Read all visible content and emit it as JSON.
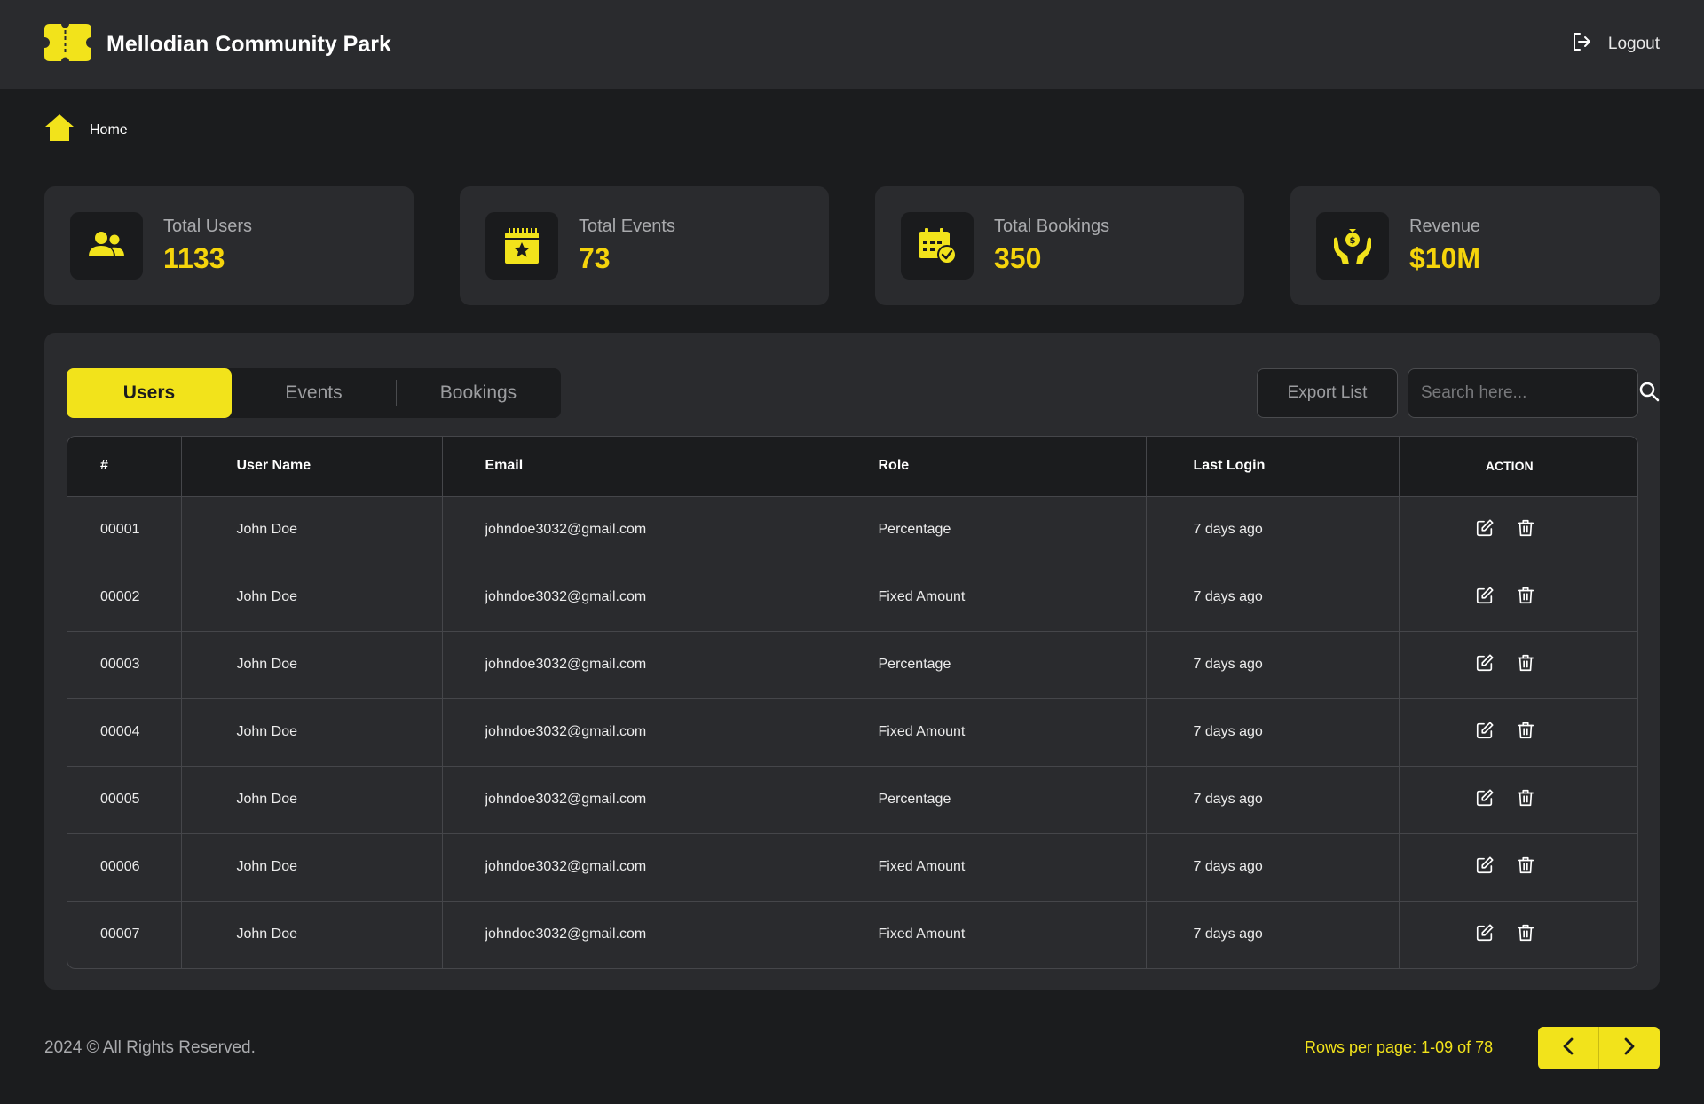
{
  "app": {
    "title": "Mellodian Community Park",
    "logout_label": "Logout"
  },
  "breadcrumb": {
    "home_label": "Home"
  },
  "stats": [
    {
      "label": "Total Users",
      "value": "1133",
      "icon": "users-icon"
    },
    {
      "label": "Total Events",
      "value": "73",
      "icon": "calendar-star-icon"
    },
    {
      "label": "Total Bookings",
      "value": "350",
      "icon": "calendar-check-icon"
    },
    {
      "label": "Revenue",
      "value": "$10M",
      "icon": "money-hands-icon"
    }
  ],
  "tabs": [
    {
      "label": "Users",
      "active": true
    },
    {
      "label": "Events",
      "active": false
    },
    {
      "label": "Bookings",
      "active": false
    }
  ],
  "toolbar": {
    "export_label": "Export List",
    "search_placeholder": "Search here..."
  },
  "table": {
    "headers": [
      "#",
      "User Name",
      "Email",
      "Role",
      "Last Login",
      "ACTION"
    ],
    "rows": [
      {
        "id": "00001",
        "name": "John Doe",
        "email": "johndoe3032@gmail.com",
        "role": "Percentage",
        "last_login": "7 days ago"
      },
      {
        "id": "00002",
        "name": "John Doe",
        "email": "johndoe3032@gmail.com",
        "role": "Fixed Amount",
        "last_login": "7 days ago"
      },
      {
        "id": "00003",
        "name": "John Doe",
        "email": "johndoe3032@gmail.com",
        "role": "Percentage",
        "last_login": "7 days ago"
      },
      {
        "id": "00004",
        "name": "John Doe",
        "email": "johndoe3032@gmail.com",
        "role": "Fixed Amount",
        "last_login": "7 days ago"
      },
      {
        "id": "00005",
        "name": "John Doe",
        "email": "johndoe3032@gmail.com",
        "role": "Percentage",
        "last_login": "7 days ago"
      },
      {
        "id": "00006",
        "name": "John Doe",
        "email": "johndoe3032@gmail.com",
        "role": "Fixed Amount",
        "last_login": "7 days ago"
      },
      {
        "id": "00007",
        "name": "John Doe",
        "email": "johndoe3032@gmail.com",
        "role": "Fixed Amount",
        "last_login": "7 days ago"
      }
    ]
  },
  "footer": {
    "copyright": "2024 © All Rights Reserved.",
    "rows_info": "Rows per page: 1-09 of 78"
  },
  "colors": {
    "accent": "#f2e31b",
    "stat_value": "#f5d40b",
    "background": "#1b1c1e",
    "surface": "#2a2b2e"
  }
}
